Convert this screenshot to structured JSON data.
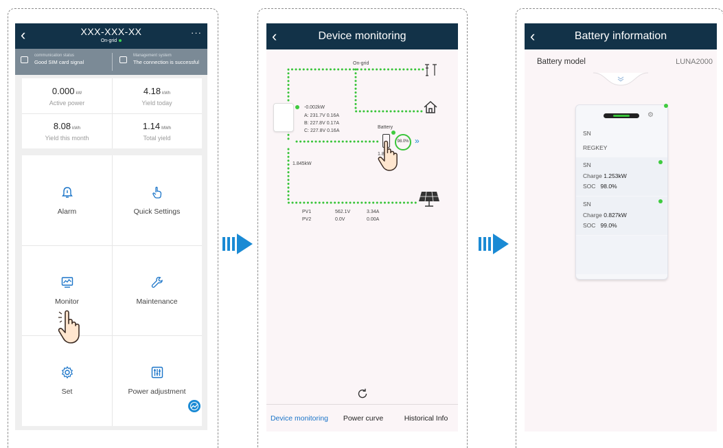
{
  "screen1": {
    "title": "XXX-XXX-XX",
    "grid_status": "On-grid",
    "comm": {
      "label": "communication status",
      "value": "Good SIM card signal"
    },
    "mgmt": {
      "label": "Management system",
      "value": "The connection is successful"
    },
    "metrics": [
      {
        "value": "0.000",
        "unit": "kW",
        "label": "Active power"
      },
      {
        "value": "4.18",
        "unit": "kWh",
        "label": "Yield today"
      },
      {
        "value": "8.08",
        "unit": "kWh",
        "label": "Yield this month"
      },
      {
        "value": "1.14",
        "unit": "MWh",
        "label": "Total yield"
      }
    ],
    "tiles": [
      {
        "label": "Alarm",
        "icon": "bell-icon"
      },
      {
        "label": "Quick Settings",
        "icon": "hand-tap-icon"
      },
      {
        "label": "Monitor",
        "icon": "monitor-chart-icon"
      },
      {
        "label": "Maintenance",
        "icon": "wrench-icon"
      },
      {
        "label": "Set",
        "icon": "gear-icon"
      },
      {
        "label": "Power adjustment",
        "icon": "sliders-icon"
      }
    ]
  },
  "screen2": {
    "title": "Device monitoring",
    "grid_label": "On-grid",
    "inverter_power": "-0.002kW",
    "phase_a": "A: 231.7V 0.16A",
    "phase_b": "B: 227.8V 0.17A",
    "phase_c": "C: 227.8V 0.16A",
    "battery_label": "Battery",
    "battery_soc": "98.0%",
    "battery_power_partial": "1.8",
    "pv_power": "1.845kW",
    "pv_rows": [
      {
        "name": "PV1",
        "voltage": "562.1V",
        "current": "3.34A"
      },
      {
        "name": "PV2",
        "voltage": "0.0V",
        "current": "0.00A"
      }
    ],
    "tabs": [
      "Device monitoring",
      "Power curve",
      "Historical Info"
    ]
  },
  "screen3": {
    "title": "Battery information",
    "model_label": "Battery model",
    "model_value": "LUNA2000",
    "sn1": "SN",
    "regkey": "REGKEY",
    "modules": [
      {
        "sn": "SN",
        "charge_label": "Charge",
        "charge_value": "1.253kW",
        "soc_label": "SOC",
        "soc_value": "98.0%"
      },
      {
        "sn": "SN",
        "charge_label": "Charge",
        "charge_value": "0.827kW",
        "soc_label": "SOC",
        "soc_value": "99.0%"
      }
    ]
  },
  "colors": {
    "header": "#123248",
    "accent": "#1a74c8",
    "flow": "#39c43a",
    "arrow": "#1a8ad4"
  }
}
